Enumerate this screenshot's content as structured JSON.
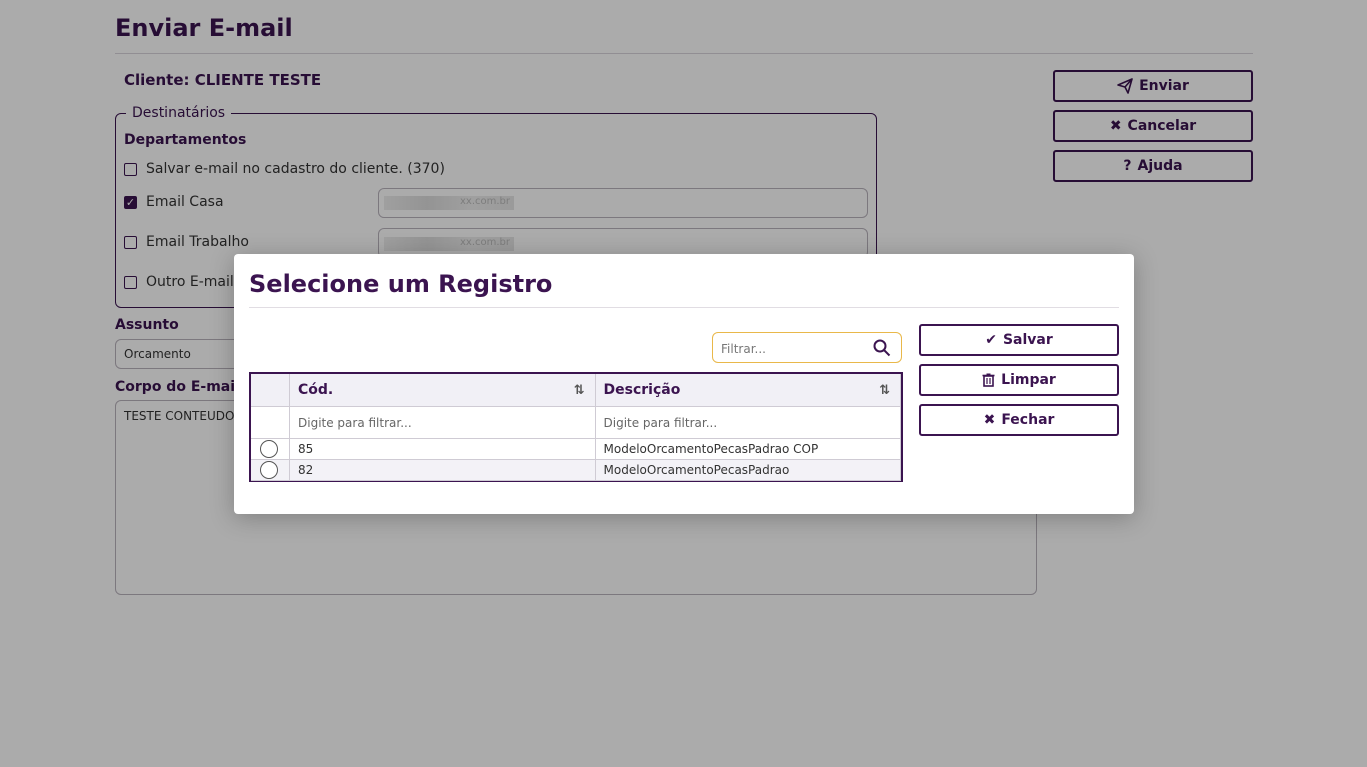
{
  "page": {
    "title": "Enviar E-mail",
    "cliente_label": "Cliente: CLIENTE TESTE",
    "destinatarios_legend": "Destinatários",
    "departamentos_label": "Departamentos",
    "checkboxes": [
      {
        "label": "Salvar e-mail no cadastro do cliente. (370)",
        "checked": false
      },
      {
        "label": "Email Casa",
        "checked": true
      },
      {
        "label": "Email Trabalho",
        "checked": false
      },
      {
        "label": "Outro E-mail",
        "checked": false
      }
    ],
    "email_casa_value": "xx.com.br",
    "email_trabalho_value": "xx.com.br",
    "assunto_label": "Assunto",
    "assunto_value": "Orcamento",
    "corpo_label": "Corpo do E-mail",
    "corpo_value": "TESTE CONTEUDO",
    "buttons": {
      "enviar": "Enviar",
      "cancelar": "Cancelar",
      "ajuda": "Ajuda"
    }
  },
  "modal": {
    "title": "Selecione um Registro",
    "filter_placeholder": "Filtrar...",
    "columns": [
      "Cód.",
      "Descrição"
    ],
    "column_filter_placeholder": "Digite para filtrar...",
    "rows": [
      {
        "cod": "85",
        "descricao": "ModeloOrcamentoPecasPadrao COP"
      },
      {
        "cod": "82",
        "descricao": "ModeloOrcamentoPecasPadrao"
      }
    ],
    "buttons": {
      "salvar": "Salvar",
      "limpar": "Limpar",
      "fechar": "Fechar"
    }
  },
  "colors": {
    "brand": "#3b1450",
    "filter_border": "#e9b84a"
  }
}
